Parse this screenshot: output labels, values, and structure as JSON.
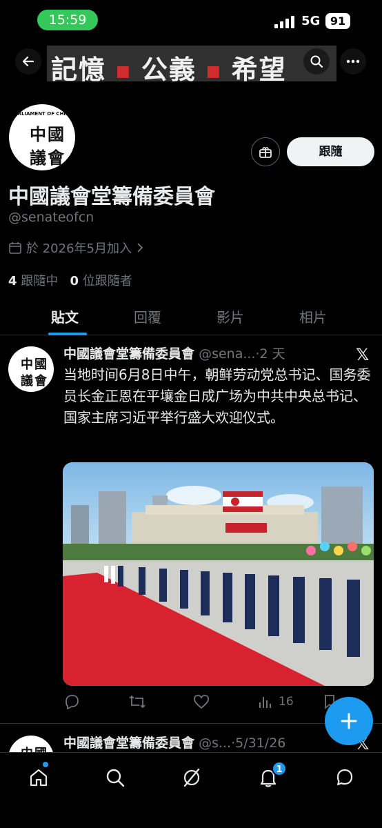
{
  "status_bar": {
    "time": "15:59",
    "network": "5G",
    "battery": "91"
  },
  "banner": {
    "word1": "記憶",
    "word2": "公義",
    "word3": "希望"
  },
  "profile": {
    "avatar_ring_text": "PARLIAMENT OF CHINA",
    "avatar_chars": [
      "中",
      "國",
      "議",
      "會"
    ],
    "follow_button": "跟隨",
    "display_name": "中國議會堂籌備委員會",
    "handle": "@senateofcn",
    "joined": "於 2026年5月加入",
    "following_count": "4",
    "following_label": "跟隨中",
    "followers_count": "0",
    "followers_label": "位跟隨者"
  },
  "tabs": [
    "貼文",
    "回覆",
    "影片",
    "相片"
  ],
  "active_tab": 0,
  "tweets": [
    {
      "name": "中國議會堂籌備委員會",
      "handle_time": "@sena...·2 天",
      "text": "当地时间6月8日中午，朝鲜劳动党总书记、国务委员长金正恩在平壤金日成广场为中共中央总书记、国家主席习近平举行盛大欢迎仪式。",
      "views": "16"
    },
    {
      "name": "中國議會堂籌備委員會",
      "handle_time": "@s...·5/31/26"
    }
  ],
  "bottom_nav": {
    "notification_badge": "1"
  },
  "colors": {
    "accent": "#1d9bf0",
    "background": "#000000",
    "text_primary": "#e7e9ea",
    "text_secondary": "#71767b",
    "status_green": "#34c759"
  }
}
